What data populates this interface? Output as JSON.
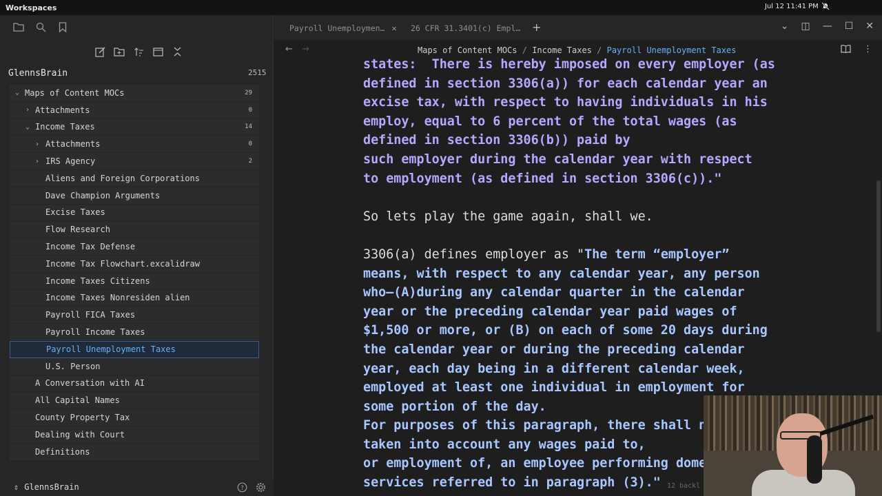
{
  "system": {
    "app_title": "Workspaces",
    "clock": "Jul 12  11:41 PM",
    "bell_icon": "bell-off-icon"
  },
  "sidebar": {
    "vault_name": "GlennsBrain",
    "vault_count": "2515",
    "tree": [
      {
        "label": "Maps of Content MOCs",
        "count": "29",
        "level": 0,
        "chevron": "⌄"
      },
      {
        "label": "Attachments",
        "count": "0",
        "level": 1,
        "chevron": "›"
      },
      {
        "label": "Income Taxes",
        "count": "14",
        "level": 1,
        "chevron": "⌄"
      },
      {
        "label": "Attachments",
        "count": "0",
        "level": 2,
        "chevron": "›"
      },
      {
        "label": "IRS Agency",
        "count": "2",
        "level": 2,
        "chevron": "›"
      },
      {
        "label": "Aliens and Foreign Corporations",
        "count": "",
        "level": 3,
        "chevron": ""
      },
      {
        "label": "Dave Champion Arguments",
        "count": "",
        "level": 3,
        "chevron": ""
      },
      {
        "label": "Excise Taxes",
        "count": "",
        "level": 3,
        "chevron": ""
      },
      {
        "label": "Flow Research",
        "count": "",
        "level": 3,
        "chevron": ""
      },
      {
        "label": "Income Tax Defense",
        "count": "",
        "level": 3,
        "chevron": ""
      },
      {
        "label": "Income Tax Flowchart.excalidraw",
        "count": "",
        "level": 3,
        "chevron": ""
      },
      {
        "label": "Income Taxes Citizens",
        "count": "",
        "level": 3,
        "chevron": ""
      },
      {
        "label": "Income Taxes Nonresiden alien",
        "count": "",
        "level": 3,
        "chevron": ""
      },
      {
        "label": "Payroll FICA Taxes",
        "count": "",
        "level": 3,
        "chevron": ""
      },
      {
        "label": "Payroll Income Taxes",
        "count": "",
        "level": 3,
        "chevron": ""
      },
      {
        "label": "Payroll Unemployment Taxes",
        "count": "",
        "level": 3,
        "chevron": "",
        "active": true
      },
      {
        "label": "U.S. Person",
        "count": "",
        "level": 3,
        "chevron": ""
      },
      {
        "label": "A Conversation with AI",
        "count": "",
        "level": 4,
        "chevron": ""
      },
      {
        "label": "All Capital Names",
        "count": "",
        "level": 4,
        "chevron": ""
      },
      {
        "label": "County Property Tax",
        "count": "",
        "level": 4,
        "chevron": ""
      },
      {
        "label": "Dealing with Court",
        "count": "",
        "level": 4,
        "chevron": ""
      },
      {
        "label": "Definitions",
        "count": "",
        "level": 4,
        "chevron": ""
      }
    ],
    "bottom_vault": "GlennsBrain"
  },
  "tabs": [
    {
      "label": "Payroll Unemploymen…",
      "close": "✕"
    },
    {
      "label": "26 CFR 31.3401(c) Empl…",
      "close": "✕"
    }
  ],
  "breadcrumb": {
    "parts": [
      "Maps of Content MOCs",
      "Income Taxes"
    ],
    "sep": "/",
    "current": "Payroll Unemployment Taxes"
  },
  "note": {
    "lines_quote1": [
      "states:  There is hereby imposed on every employer (as",
      "defined in section 3306(a)) for each calendar year an",
      "excise tax, with respect to having individuals in his",
      "employ, equal to 6 percent of the total wages (as",
      "defined in section 3306(b)) paid by",
      "such employer during the calendar year with respect",
      "to employment (as defined in section 3306(c)).\""
    ],
    "plain1": "So lets play the game again, shall we.",
    "plain2": "3306(a) defines employer as \"",
    "quote2_first": "The term “employer”",
    "lines_quote2": [
      "means, with respect to any calendar year, any person",
      "who—(A)during any calendar quarter in the calendar",
      "year or the preceding calendar year paid wages of",
      "$1,500 or more, or (B) on each of some 20 days during",
      "the calendar year or during the preceding calendar",
      "year, each day being in a different calendar week,",
      "employed at least one individual in employment for",
      "some portion of the day.",
      "For purposes of this paragraph, there shall n",
      "taken into account any wages paid to,",
      "or employment of, an employee performing dome",
      "services referred to in paragraph (3).\""
    ],
    "backlinks": "12 backl"
  }
}
